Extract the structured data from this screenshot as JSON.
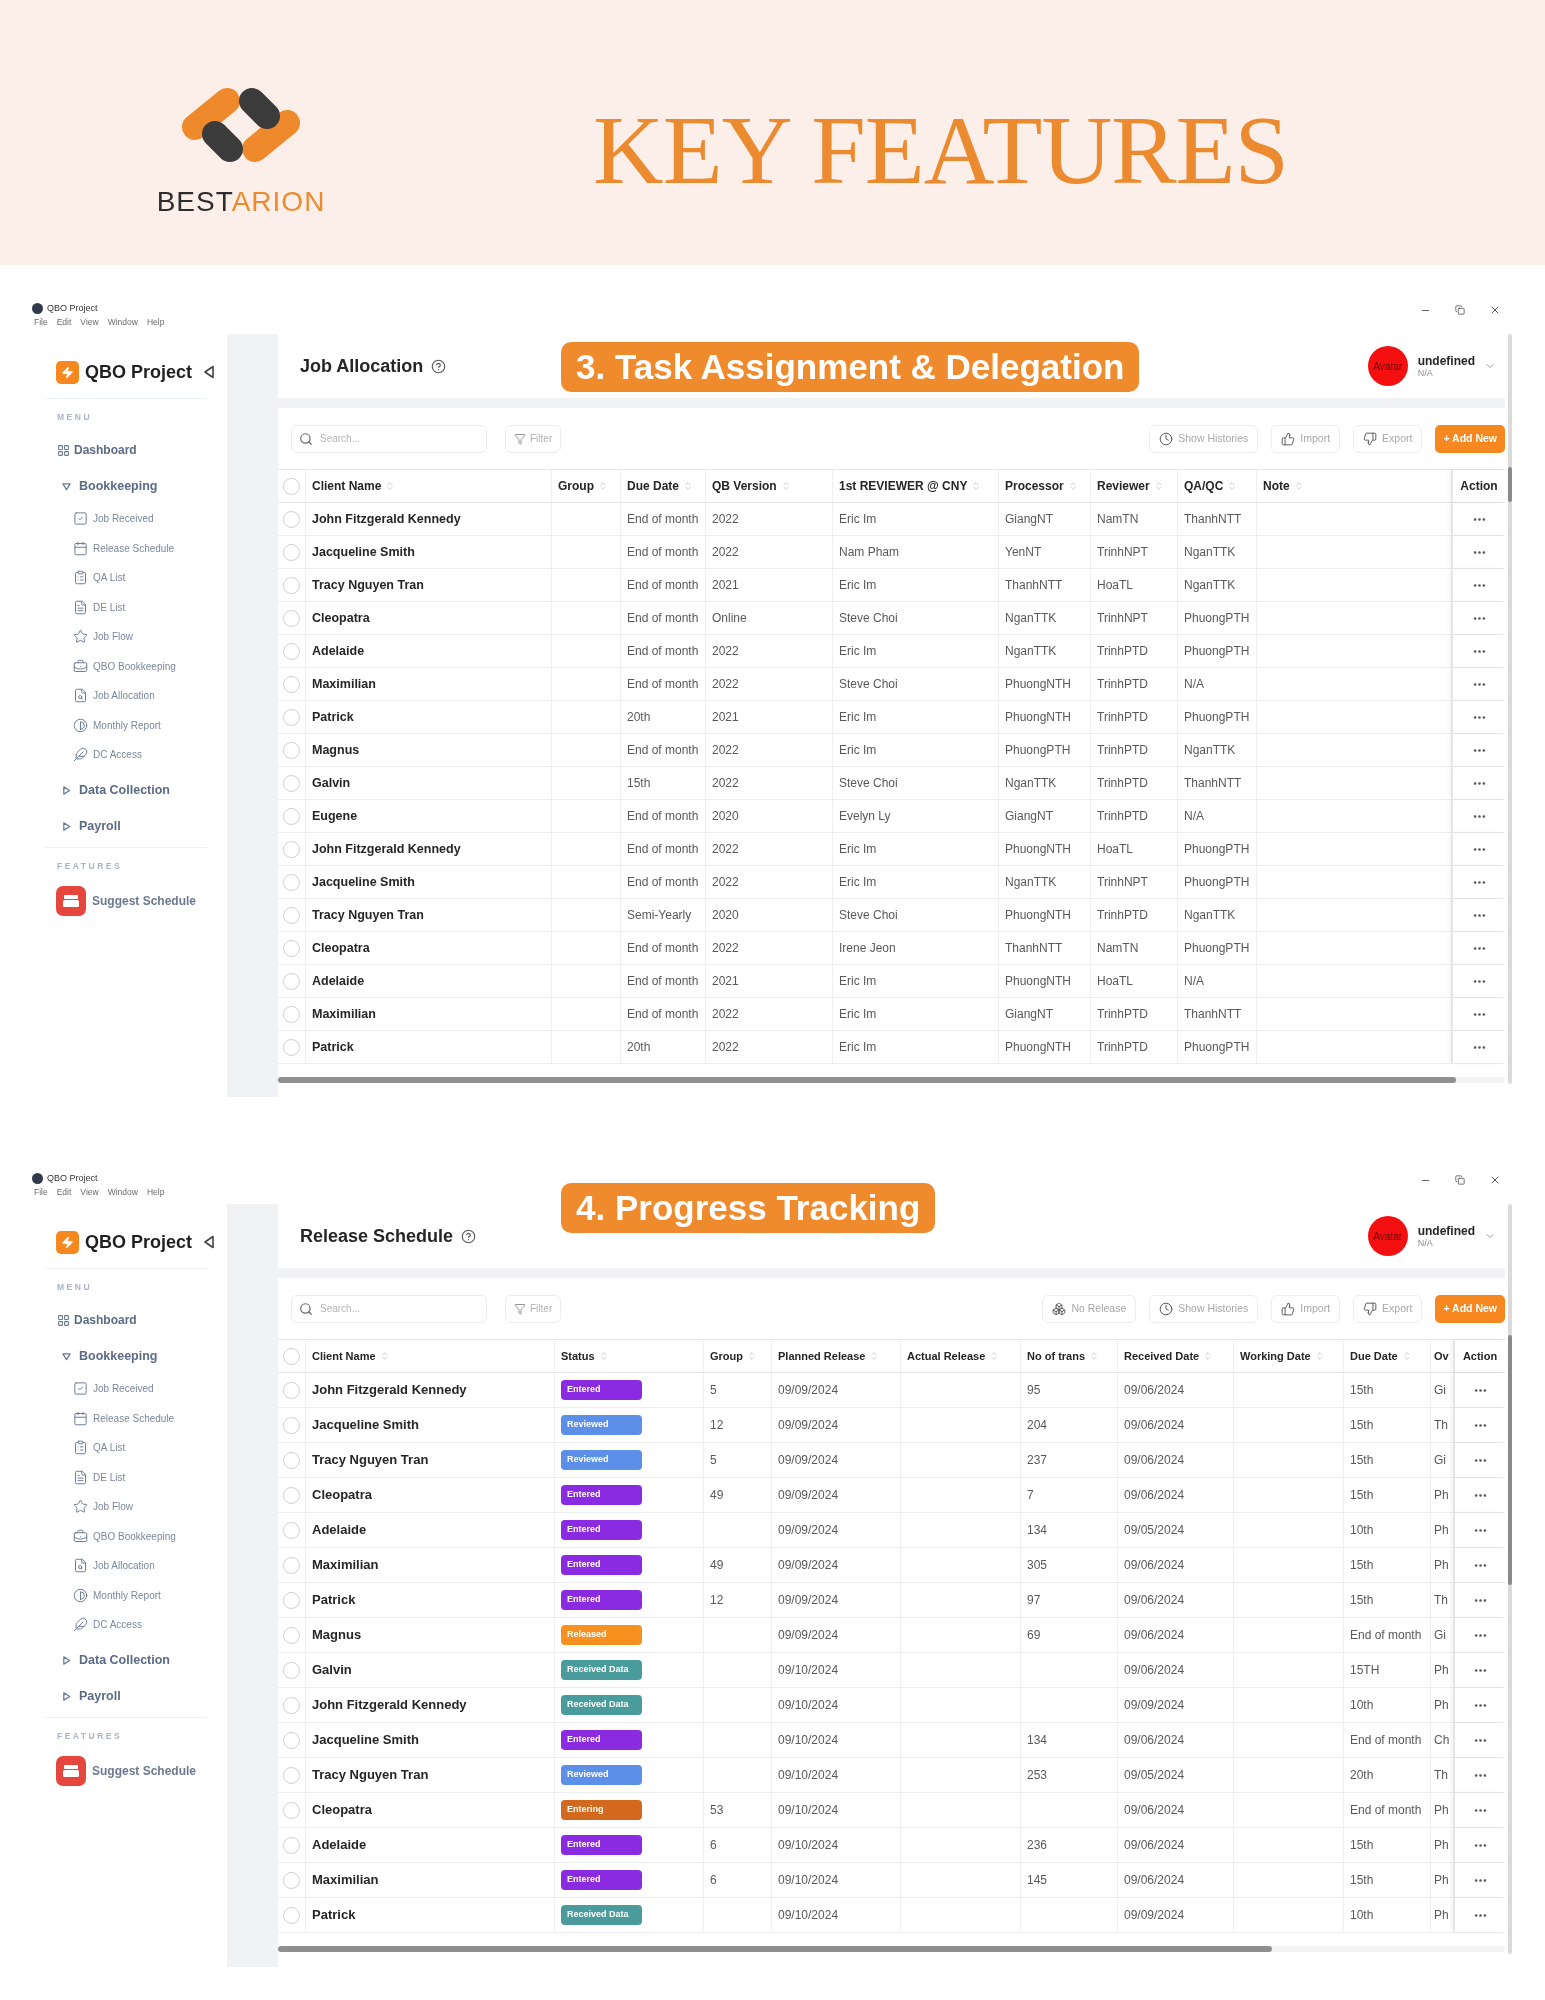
{
  "header": {
    "wordmark": [
      {
        "text": "BEST",
        "color": "#2d2d2d"
      },
      {
        "text": "ARION",
        "color": "#ec8a2f"
      }
    ],
    "title": "KEY FEATURES"
  },
  "screens": [
    {
      "app_title": "QBO Project",
      "menu_bar": [
        "File",
        "Edit",
        "View",
        "Window",
        "Help"
      ],
      "sidebar": {
        "brand": "QBO Project",
        "sections": [
          {
            "title": "MENU",
            "items": [
              {
                "label": "Dashboard",
                "kind": "link"
              },
              {
                "label": "Bookkeeping",
                "kind": "group",
                "expanded": true,
                "children": [
                  {
                    "label": "Job Received"
                  },
                  {
                    "label": "Release Schedule"
                  },
                  {
                    "label": "QA List"
                  },
                  {
                    "label": "DE List"
                  },
                  {
                    "label": "Job Flow"
                  },
                  {
                    "label": "QBO Bookkeeping"
                  },
                  {
                    "label": "Job Allocation"
                  },
                  {
                    "label": "Monthly Report"
                  },
                  {
                    "label": "DC Access"
                  }
                ]
              },
              {
                "label": "Data Collection",
                "kind": "group",
                "expanded": false
              },
              {
                "label": "Payroll",
                "kind": "group",
                "expanded": false
              }
            ]
          },
          {
            "title": "FEATURES",
            "items": [
              {
                "label": "Suggest Schedule",
                "kind": "feature"
              }
            ]
          }
        ]
      },
      "page_title": "Job Allocation",
      "banner": "3. Task Assignment & Delegation",
      "user": {
        "avatar_text": "Avatar",
        "name": "undefined",
        "role": "N/A"
      },
      "toolbar": {
        "search_placeholder": "Search...",
        "filter": "Filter",
        "actions": [
          {
            "kind": "history",
            "label": "Show Histories"
          },
          {
            "kind": "import",
            "label": "Import"
          },
          {
            "kind": "export",
            "label": "Export"
          },
          {
            "kind": "add",
            "label": "+ Add New"
          }
        ]
      },
      "table": {
        "all_checked": false,
        "columns": [
          {
            "label": "Client Name",
            "sortable": true,
            "kind": "name"
          },
          {
            "label": "Group",
            "sortable": true,
            "kind": "text"
          },
          {
            "label": "Due Date",
            "sortable": true,
            "kind": "text"
          },
          {
            "label": "QB Version",
            "sortable": true,
            "kind": "text"
          },
          {
            "label": "1st REVIEWER @ CNY",
            "sortable": true,
            "kind": "text"
          },
          {
            "label": "Processor",
            "sortable": true,
            "kind": "text"
          },
          {
            "label": "Reviewer",
            "sortable": true,
            "kind": "text"
          },
          {
            "label": "QA/QC",
            "sortable": true,
            "kind": "text"
          },
          {
            "label": "Note",
            "sortable": true,
            "kind": "text"
          },
          {
            "label": "Action",
            "sortable": false,
            "kind": "menu"
          }
        ],
        "rows": [
          {
            "checked": false,
            "cells": [
              "John Fitzgerald Kennedy",
              null,
              "End of month",
              "2022",
              "Eric Im",
              "GiangNT",
              "NamTN",
              "ThanhNTT",
              null
            ]
          },
          {
            "checked": false,
            "cells": [
              "Jacqueline Smith",
              null,
              "End of month",
              "2022",
              "Nam Pham",
              "YenNT",
              "TrinhNPT",
              "NganTTK",
              null
            ]
          },
          {
            "checked": false,
            "cells": [
              "Tracy Nguyen Tran",
              null,
              "End of month",
              "2021",
              "Eric Im",
              "ThanhNTT",
              "HoaTL",
              "NganTTK",
              null
            ]
          },
          {
            "checked": false,
            "cells": [
              "Cleopatra",
              null,
              "End of month",
              "Online",
              "Steve Choi",
              "NganTTK",
              "TrinhNPT",
              "PhuongPTH",
              null
            ]
          },
          {
            "checked": false,
            "cells": [
              "Adelaide",
              null,
              "End of month",
              "2022",
              "Eric Im",
              "NganTTK",
              "TrinhPTD",
              "PhuongPTH",
              null
            ]
          },
          {
            "checked": false,
            "cells": [
              "Maximilian",
              null,
              "End of month",
              "2022",
              "Steve Choi",
              "PhuongNTH",
              "TrinhPTD",
              "N/A",
              null
            ]
          },
          {
            "checked": false,
            "cells": [
              "Patrick",
              null,
              "20th",
              "2021",
              "Eric Im",
              "PhuongNTH",
              "TrinhPTD",
              "PhuongPTH",
              null
            ]
          },
          {
            "checked": false,
            "cells": [
              "Magnus",
              null,
              "End of month",
              "2022",
              "Eric Im",
              "PhuongPTH",
              "TrinhPTD",
              "NganTTK",
              null
            ]
          },
          {
            "checked": false,
            "cells": [
              "Galvin",
              null,
              "15th",
              "2022",
              "Steve Choi",
              "NganTTK",
              "TrinhPTD",
              "ThanhNTT",
              null
            ]
          },
          {
            "checked": false,
            "cells": [
              "Eugene",
              null,
              "End of month",
              "2020",
              "Evelyn Ly",
              "GiangNT",
              "TrinhPTD",
              "N/A",
              null
            ]
          },
          {
            "checked": false,
            "cells": [
              "John Fitzgerald Kennedy",
              null,
              "End of month",
              "2022",
              "Eric Im",
              "PhuongNTH",
              "HoaTL",
              "PhuongPTH",
              null
            ]
          },
          {
            "checked": false,
            "cells": [
              "Jacqueline Smith",
              null,
              "End of month",
              "2022",
              "Eric Im",
              "NganTTK",
              "TrinhNPT",
              "PhuongPTH",
              null
            ]
          },
          {
            "checked": false,
            "cells": [
              "Tracy Nguyen Tran",
              null,
              "Semi-Yearly",
              "2020",
              "Steve Choi",
              "PhuongNTH",
              "TrinhPTD",
              "NganTTK",
              null
            ]
          },
          {
            "checked": false,
            "cells": [
              "Cleopatra",
              null,
              "End of month",
              "2022",
              "Irene Jeon",
              "ThanhNTT",
              "NamTN",
              "PhuongPTH",
              null
            ]
          },
          {
            "checked": false,
            "cells": [
              "Adelaide",
              null,
              "End of month",
              "2021",
              "Eric Im",
              "PhuongNTH",
              "HoaTL",
              "N/A",
              null
            ]
          },
          {
            "checked": false,
            "cells": [
              "Maximilian",
              null,
              "End of month",
              "2022",
              "Eric Im",
              "GiangNT",
              "TrinhPTD",
              "ThanhNTT",
              null
            ]
          },
          {
            "checked": false,
            "cells": [
              "Patrick",
              null,
              "20th",
              "2022",
              "Eric Im",
              "PhuongNTH",
              "TrinhPTD",
              "PhuongPTH",
              null
            ]
          }
        ]
      }
    },
    {
      "app_title": "QBO Project",
      "menu_bar": [
        "File",
        "Edit",
        "View",
        "Window",
        "Help"
      ],
      "sidebar": {
        "brand": "QBO Project",
        "sections": [
          {
            "title": "MENU",
            "items": [
              {
                "label": "Dashboard",
                "kind": "link"
              },
              {
                "label": "Bookkeeping",
                "kind": "group",
                "expanded": true,
                "children": [
                  {
                    "label": "Job Received"
                  },
                  {
                    "label": "Release Schedule"
                  },
                  {
                    "label": "QA List"
                  },
                  {
                    "label": "DE List"
                  },
                  {
                    "label": "Job Flow"
                  },
                  {
                    "label": "QBO Bookkeeping"
                  },
                  {
                    "label": "Job Allocation"
                  },
                  {
                    "label": "Monthly Report"
                  },
                  {
                    "label": "DC Access"
                  }
                ]
              },
              {
                "label": "Data Collection",
                "kind": "group",
                "expanded": false
              },
              {
                "label": "Payroll",
                "kind": "group",
                "expanded": false
              }
            ]
          },
          {
            "title": "FEATURES",
            "items": [
              {
                "label": "Suggest Schedule",
                "kind": "feature"
              }
            ]
          }
        ]
      },
      "page_title": "Release Schedule",
      "banner": "4. Progress Tracking",
      "user": {
        "avatar_text": "Avatar",
        "name": "undefined",
        "role": "N/A"
      },
      "toolbar": {
        "search_placeholder": "Search...",
        "filter": "Filter",
        "actions": [
          {
            "kind": "no_release",
            "label": "No Release"
          },
          {
            "kind": "history",
            "label": "Show Histories"
          },
          {
            "kind": "import",
            "label": "Import"
          },
          {
            "kind": "export",
            "label": "Export"
          },
          {
            "kind": "add",
            "label": "+ Add New"
          }
        ]
      },
      "table": {
        "all_checked": false,
        "columns": [
          {
            "label": "Client Name",
            "sortable": true,
            "kind": "name"
          },
          {
            "label": "Status",
            "sortable": true,
            "kind": "badge"
          },
          {
            "label": "Group",
            "sortable": true,
            "kind": "text"
          },
          {
            "label": "Planned Release",
            "sortable": true,
            "kind": "text"
          },
          {
            "label": "Actual Release",
            "sortable": true,
            "kind": "text"
          },
          {
            "label": "No of trans",
            "sortable": true,
            "kind": "text"
          },
          {
            "label": "Received Date",
            "sortable": true,
            "kind": "text"
          },
          {
            "label": "Working Date",
            "sortable": true,
            "kind": "text"
          },
          {
            "label": "Due Date",
            "sortable": true,
            "kind": "text"
          },
          {
            "label": "Ov",
            "kind": "text"
          },
          {
            "label": "Action",
            "sortable": false,
            "kind": "menu"
          }
        ],
        "rows": [
          {
            "checked": false,
            "cells": [
              "John Fitzgerald Kennedy",
              {
                "label": "Entered",
                "color": "#8a2be2"
              },
              "5",
              "09/09/2024",
              null,
              "95",
              "09/06/2024",
              null,
              "15th",
              "Gi"
            ]
          },
          {
            "checked": false,
            "cells": [
              "Jacqueline Smith",
              {
                "label": "Reviewed",
                "color": "#5b8fe8"
              },
              "12",
              "09/09/2024",
              null,
              "204",
              "09/06/2024",
              null,
              "15th",
              "Th"
            ]
          },
          {
            "checked": false,
            "cells": [
              "Tracy Nguyen Tran",
              {
                "label": "Reviewed",
                "color": "#5b8fe8"
              },
              "5",
              "09/09/2024",
              null,
              "237",
              "09/06/2024",
              null,
              "15th",
              "Gi"
            ]
          },
          {
            "checked": false,
            "cells": [
              "Cleopatra",
              {
                "label": "Entered",
                "color": "#8a2be2"
              },
              "49",
              "09/09/2024",
              null,
              "7",
              "09/06/2024",
              null,
              "15th",
              "Ph"
            ]
          },
          {
            "checked": false,
            "cells": [
              "Adelaide",
              {
                "label": "Entered",
                "color": "#8a2be2"
              },
              null,
              "09/09/2024",
              null,
              "134",
              "09/05/2024",
              null,
              "10th",
              "Ph"
            ]
          },
          {
            "checked": false,
            "cells": [
              "Maximilian",
              {
                "label": "Entered",
                "color": "#8a2be2"
              },
              "49",
              "09/09/2024",
              null,
              "305",
              "09/06/2024",
              null,
              "15th",
              "Ph"
            ]
          },
          {
            "checked": false,
            "cells": [
              "Patrick",
              {
                "label": "Entered",
                "color": "#8a2be2"
              },
              "12",
              "09/09/2024",
              null,
              "97",
              "09/06/2024",
              null,
              "15th",
              "Th"
            ]
          },
          {
            "checked": false,
            "cells": [
              "Magnus",
              {
                "label": "Released",
                "color": "#f7901e"
              },
              null,
              "09/09/2024",
              null,
              "69",
              "09/06/2024",
              null,
              "End of month",
              "Gi"
            ]
          },
          {
            "checked": false,
            "cells": [
              "Galvin",
              {
                "label": "Received Data",
                "color": "#4a9c9c"
              },
              null,
              "09/10/2024",
              null,
              null,
              "09/06/2024",
              null,
              "15TH",
              "Ph"
            ]
          },
          {
            "checked": false,
            "cells": [
              "John Fitzgerald Kennedy",
              {
                "label": "Received Data",
                "color": "#4a9c9c"
              },
              null,
              "09/10/2024",
              null,
              null,
              "09/09/2024",
              null,
              "10th",
              "Ph"
            ]
          },
          {
            "checked": false,
            "cells": [
              "Jacqueline Smith",
              {
                "label": "Entered",
                "color": "#8a2be2"
              },
              null,
              "09/10/2024",
              null,
              "134",
              "09/06/2024",
              null,
              "End of month",
              "Ch"
            ]
          },
          {
            "checked": false,
            "cells": [
              "Tracy Nguyen Tran",
              {
                "label": "Reviewed",
                "color": "#5b8fe8"
              },
              null,
              "09/10/2024",
              null,
              "253",
              "09/05/2024",
              null,
              "20th",
              "Th"
            ]
          },
          {
            "checked": false,
            "cells": [
              "Cleopatra",
              {
                "label": "Entering",
                "color": "#d2691e"
              },
              "53",
              "09/10/2024",
              null,
              null,
              "09/06/2024",
              null,
              "End of month",
              "Ph"
            ]
          },
          {
            "checked": false,
            "cells": [
              "Adelaide",
              {
                "label": "Entered",
                "color": "#8a2be2"
              },
              "6",
              "09/10/2024",
              null,
              "236",
              "09/06/2024",
              null,
              "15th",
              "Ph"
            ]
          },
          {
            "checked": false,
            "cells": [
              "Maximilian",
              {
                "label": "Entered",
                "color": "#8a2be2"
              },
              "6",
              "09/10/2024",
              null,
              "145",
              "09/06/2024",
              null,
              "15th",
              "Ph"
            ]
          },
          {
            "checked": false,
            "cells": [
              "Patrick",
              {
                "label": "Received Data",
                "color": "#4a9c9c"
              },
              null,
              "09/10/2024",
              null,
              null,
              "09/09/2024",
              null,
              "10th",
              "Ph"
            ]
          }
        ]
      }
    }
  ]
}
